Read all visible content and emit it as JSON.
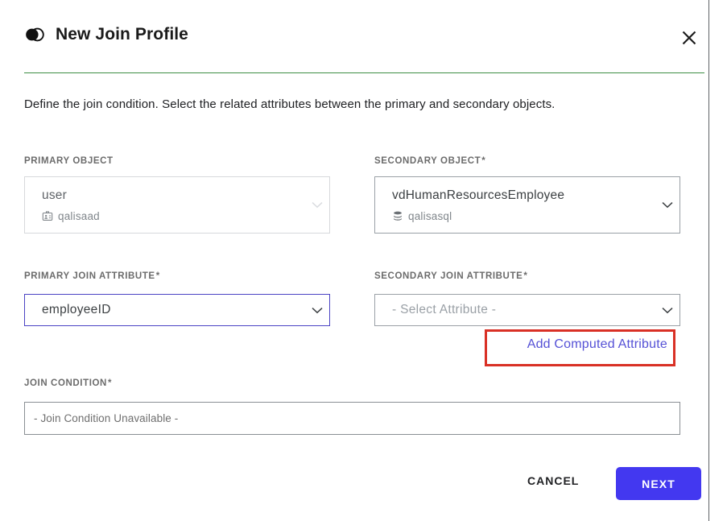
{
  "dialog": {
    "title": "New Join Profile",
    "title_icon": "join-venn-icon",
    "close_icon": "close-icon",
    "description": "Define the join condition. Select the related attributes between the primary and secondary objects.",
    "accent_divider_color": "#3d8f45"
  },
  "fields": {
    "primary_object": {
      "label": "PRIMARY OBJECT",
      "required": "",
      "value": "user",
      "source": "qalisaad",
      "source_icon": "id-badge-icon",
      "chevron_icon": "chevron-down-icon",
      "disabled": true
    },
    "secondary_object": {
      "label": "SECONDARY OBJECT",
      "required": "*",
      "value": "vdHumanResourcesEmployee",
      "source": "qalisasql",
      "source_icon": "database-icon",
      "chevron_icon": "chevron-down-icon"
    },
    "primary_join_attribute": {
      "label": "PRIMARY JOIN ATTRIBUTE",
      "required": "*",
      "value": "employeeID",
      "chevron_icon": "chevron-down-icon",
      "focus_border_color": "#4b43c4"
    },
    "secondary_join_attribute": {
      "label": "SECONDARY JOIN ATTRIBUTE",
      "required": "*",
      "placeholder": "- Select Attribute -",
      "chevron_icon": "chevron-down-icon"
    },
    "join_condition": {
      "label": "JOIN CONDITION",
      "required": "*",
      "placeholder": "- Join Condition Unavailable -"
    }
  },
  "links": {
    "add_computed_attribute": "Add Computed Attribute",
    "add_computed_attribute_color": "#5551d6"
  },
  "annotation": {
    "highlight_color": "#d93025",
    "target": "add-computed-attribute-link"
  },
  "footer": {
    "cancel_label": "CANCEL",
    "next_label": "NEXT",
    "next_color": "#4338f0"
  }
}
